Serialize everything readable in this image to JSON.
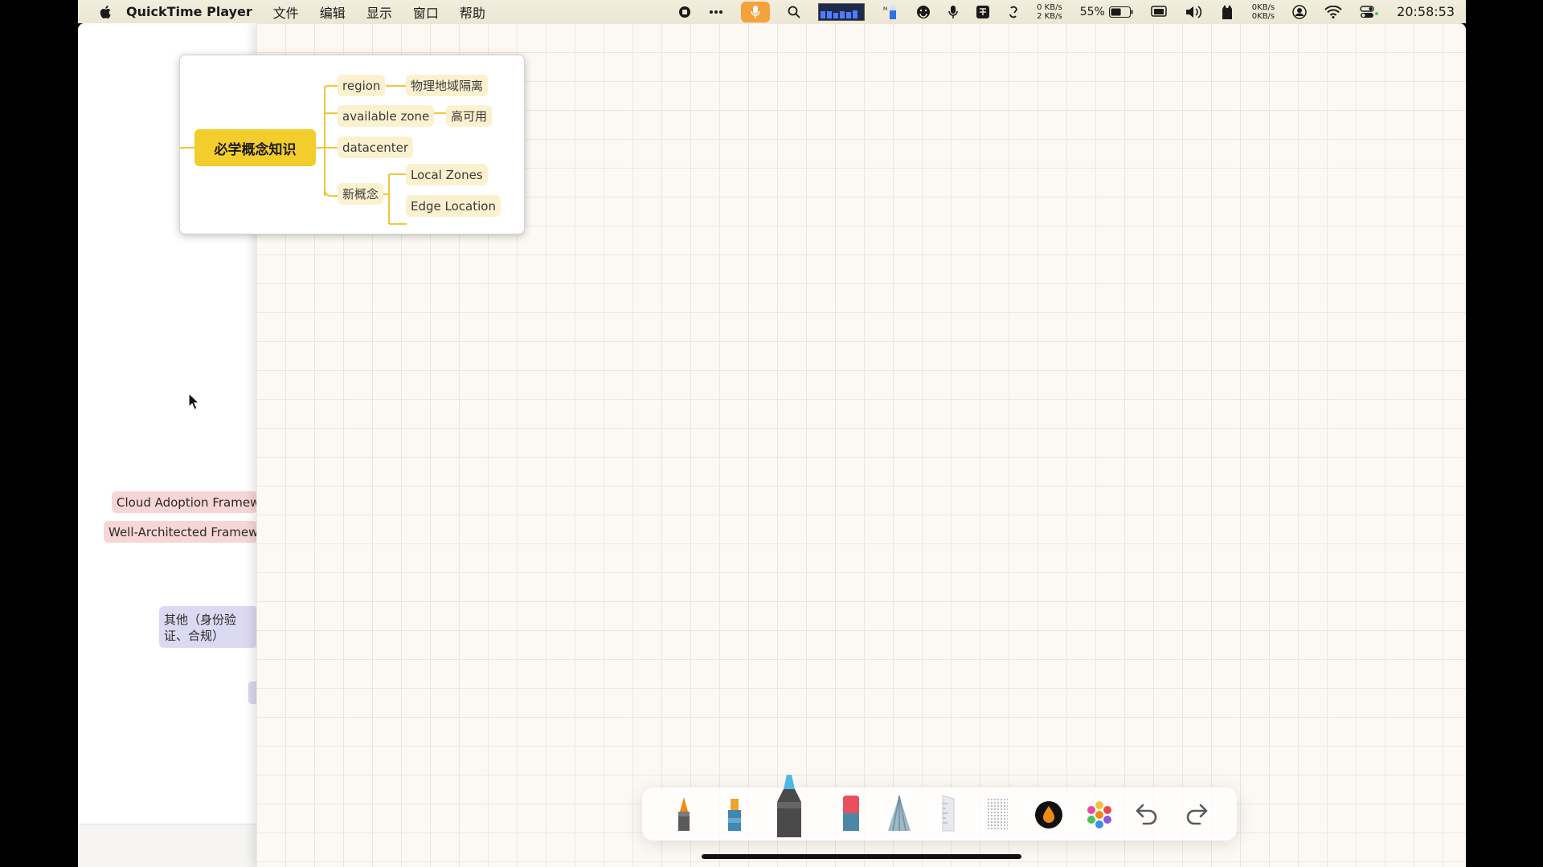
{
  "menubar": {
    "app_name": "QuickTime Player",
    "menus": [
      "文件",
      "编辑",
      "显示",
      "窗口",
      "帮助"
    ],
    "net_up": "0 KB/s",
    "net_down": "2 KB/s",
    "battery_percent": "55%",
    "net2_up": "0KB/s",
    "net2_down": "0KB/s",
    "clock": "20:58:53",
    "cpu_levels": [
      0.55,
      0.55,
      0.45,
      0.55,
      0.5,
      0.6
    ],
    "accent_mic": "#f3a23c"
  },
  "mindmap": {
    "root": "必学概念知识",
    "region": "region",
    "region_child": "物理地域隔离",
    "available_zone": "available zone",
    "available_zone_child": "高可用",
    "datacenter": "datacenter",
    "new_concepts": "新概念",
    "local_zones": "Local Zones",
    "edge_location": "Edge Location",
    "root_color": "#f3cd2c",
    "node_color": "#fbf1cf"
  },
  "left_panel": {
    "cloud_adoption": "Cloud Adoption Framework",
    "well_architected": "Well-Architected Framework",
    "other": "其他（身份验证、合规）"
  },
  "toolbar": {
    "tools": [
      "pen-icon",
      "highlighter-icon",
      "marker-icon",
      "eraser-icon",
      "lasso-icon",
      "ruler-icon",
      "texture-icon",
      "color-picker-icon",
      "palette-icon",
      "undo-icon",
      "redo-icon"
    ],
    "selected_tool": "marker-icon",
    "current_color": "#f08a12"
  }
}
